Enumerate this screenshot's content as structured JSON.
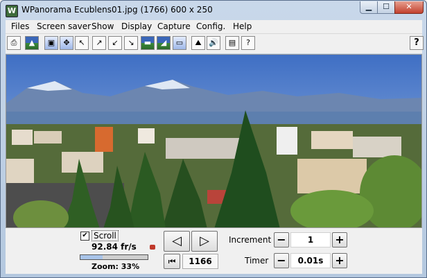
{
  "window": {
    "title": "WPanorama  Ecublens01.jpg  (1766) 600 x 250",
    "app_icon": "W"
  },
  "menu": [
    "Files",
    "Screen saver",
    "Show",
    "Display",
    "Capture",
    "Config.",
    "Help"
  ],
  "toolbar": {
    "buttons": [
      {
        "icon": "open-file-icon"
      },
      {
        "icon": "picture-icon"
      },
      {
        "icon": "fit-window-icon"
      },
      {
        "icon": "move-icon"
      },
      {
        "icon": "arrow-upleft-icon"
      },
      {
        "icon": "arrow-downleft-icon"
      },
      {
        "icon": "arrow-upright-icon"
      },
      {
        "icon": "arrow-downright-icon"
      },
      {
        "icon": "panorama-view-icon"
      },
      {
        "icon": "panorama-wide-icon"
      },
      {
        "icon": "panorama-strip-icon"
      },
      {
        "icon": "landscape-icon"
      },
      {
        "icon": "sound-icon"
      },
      {
        "icon": "book-icon"
      },
      {
        "icon": "help-book-icon"
      }
    ],
    "help_label": "?"
  },
  "controls": {
    "scroll_label": "Scroll",
    "scroll_checked": true,
    "fps": "92.84 fr/s",
    "zoom_label": "Zoom: 33%",
    "zoom_fraction": 0.33,
    "position": "1166",
    "increment_label": "Increment",
    "increment_value": "1",
    "timer_label": "Timer",
    "timer_value": "0.01s",
    "minus": "−",
    "plus": "+"
  }
}
